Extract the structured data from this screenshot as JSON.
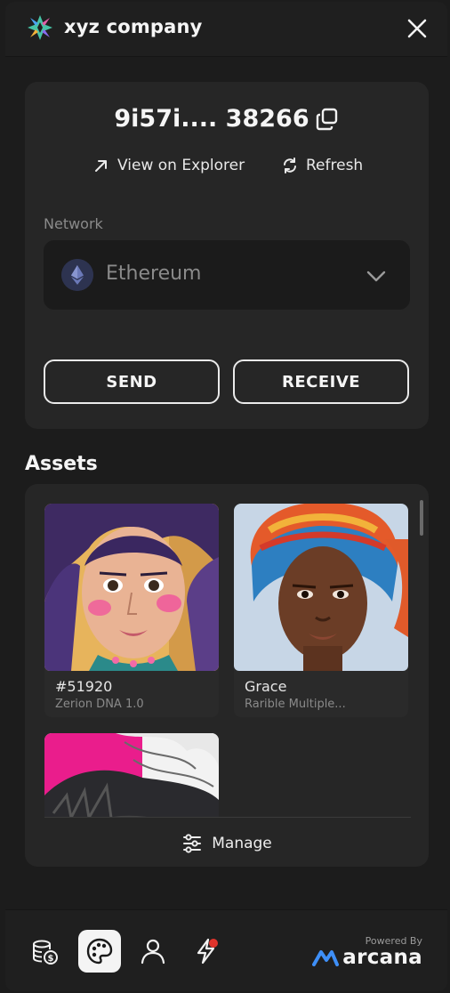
{
  "header": {
    "brand": "xyz company"
  },
  "wallet": {
    "address": "9i57i.... 38266",
    "view_explorer": "View on Explorer",
    "refresh": "Refresh"
  },
  "network": {
    "label": "Network",
    "selected": "Ethereum"
  },
  "actions": {
    "send": "SEND",
    "receive": "RECEIVE"
  },
  "assets": {
    "title": "Assets",
    "items": [
      {
        "title": "#51920",
        "collection": "Zerion DNA 1.0"
      },
      {
        "title": "Grace",
        "collection": "Rarible Multiple..."
      },
      {
        "title": "",
        "collection": ""
      }
    ],
    "manage": "Manage"
  },
  "footer": {
    "powered_by": "Powered By",
    "brand": "arcana"
  },
  "colors": {
    "background": "#1c1c1c",
    "card": "#262626",
    "accent_blue": "#3e8ff7",
    "notification_red": "#e0342c"
  },
  "icons": [
    "close-icon",
    "copy-icon",
    "arrow-up-right-icon",
    "refresh-icon",
    "ethereum-icon",
    "chevron-down-icon",
    "sliders-icon",
    "coins-icon",
    "palette-icon",
    "user-icon",
    "bolt-icon"
  ]
}
